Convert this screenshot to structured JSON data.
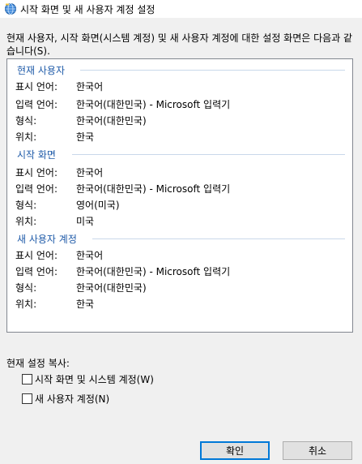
{
  "window": {
    "title": "시작 화면 및 새 사용자 계정 설정"
  },
  "description": "현재 사용자, 시작 화면(시스템 계정) 및 새 사용자 계정에 대한 설정 화면은 다음과 같습니다(S).",
  "sections": [
    {
      "title": "현재 사용자",
      "rows": [
        {
          "label": "표시 언어:",
          "value": "한국어"
        },
        {
          "label": "입력 언어:",
          "value": "한국어(대한민국) - Microsoft 입력기"
        },
        {
          "label": "형식:",
          "value": "한국어(대한민국)"
        },
        {
          "label": "위치:",
          "value": "한국"
        }
      ]
    },
    {
      "title": "시작 화면",
      "rows": [
        {
          "label": "표시 언어:",
          "value": "한국어"
        },
        {
          "label": "입력 언어:",
          "value": "한국어(대한민국) - Microsoft 입력기"
        },
        {
          "label": "형식:",
          "value": "영어(미국)"
        },
        {
          "label": "위치:",
          "value": "미국"
        }
      ]
    },
    {
      "title": "새 사용자 계정",
      "rows": [
        {
          "label": "표시 언어:",
          "value": "한국어"
        },
        {
          "label": "입력 언어:",
          "value": "한국어(대한민국) - Microsoft 입력기"
        },
        {
          "label": "형식:",
          "value": "한국어(대한민국)"
        },
        {
          "label": "위치:",
          "value": "한국"
        }
      ]
    }
  ],
  "copy_settings": {
    "label": "현재 설정 복사:",
    "checkboxes": [
      {
        "label": "시작 화면 및 시스템 계정(W)",
        "checked": false
      },
      {
        "label": "새 사용자 계정(N)",
        "checked": false
      }
    ]
  },
  "buttons": {
    "ok": "확인",
    "cancel": "취소"
  },
  "colors": {
    "section_header": "#1e5aa8",
    "default_button_border": "#0078d7"
  }
}
